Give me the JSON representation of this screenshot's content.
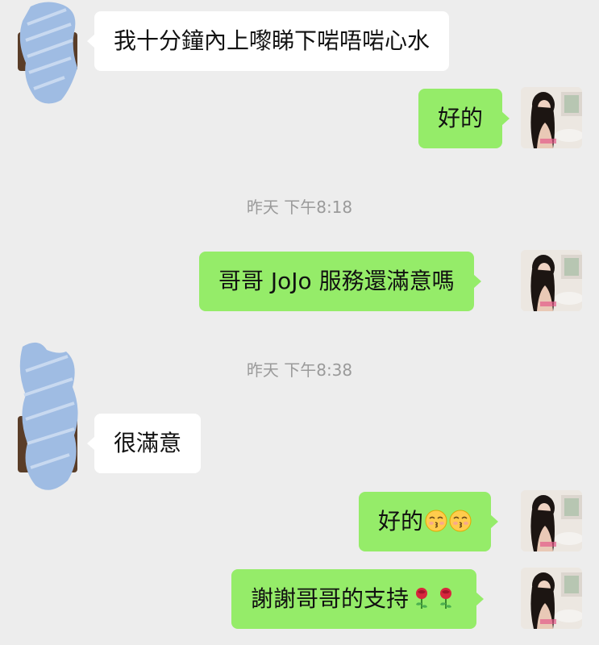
{
  "messages": [
    {
      "text": "我十分鐘內上嚟睇下啱唔啱心水"
    },
    {
      "text": "好的"
    },
    {
      "text": "哥哥 JoJo 服務還滿意嗎"
    },
    {
      "text": "很滿意"
    },
    {
      "text": "好的"
    },
    {
      "text": "謝謝哥哥的支持"
    }
  ],
  "timestamps": [
    {
      "label": "昨天 下午8:18"
    },
    {
      "label": "昨天 下午8:38"
    }
  ],
  "icons": {
    "kiss": "kissing-face-icon",
    "rose": "rose-icon"
  },
  "colors": {
    "background": "#ededed",
    "incoming_bubble": "#ffffff",
    "outgoing_bubble": "#95ec69",
    "timestamp_text": "#9a9a9a",
    "redaction_scribble": "#9fbce3"
  }
}
